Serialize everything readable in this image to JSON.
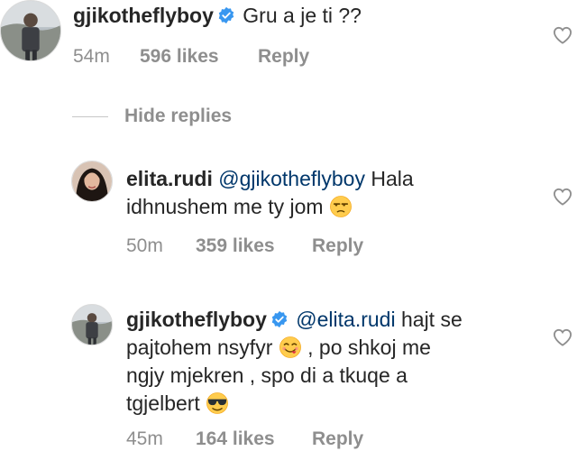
{
  "comments": [
    {
      "username": "gjikotheflyboy",
      "verified": true,
      "mention": "",
      "text": "Gru a je ti ??",
      "time": "54m",
      "likes": "596 likes",
      "reply": "Reply"
    },
    {
      "username": "elita.rudi",
      "verified": false,
      "mention": "@gjikotheflyboy",
      "text_line1": "Hala",
      "text_line2": "idhnushem me ty jom",
      "emoji": "unamused-face-emoji",
      "time": "50m",
      "likes": "359 likes",
      "reply": "Reply"
    },
    {
      "username": "gjikotheflyboy",
      "verified": true,
      "mention": "@elita.rudi",
      "text_line1": "hajt se",
      "text_line2a": "pajtohem nsyfyr",
      "emoji_a": "face-savoring-food-emoji",
      "text_line2b": ", po shkoj me",
      "text_line3": "ngjy  mjekren , spo di a tkuqe a",
      "text_line4": "tgjelbert",
      "emoji_b": "smiling-face-with-sunglasses-emoji",
      "time": "45m",
      "likes": "164 likes",
      "reply": "Reply"
    }
  ],
  "hide_replies": "Hide replies",
  "colors": {
    "text": "#262626",
    "secondary": "#8e8e8e",
    "mention": "#00376b",
    "verified": "#3897f0"
  },
  "icons": [
    "heart-outline-icon",
    "verified-badge-icon"
  ]
}
